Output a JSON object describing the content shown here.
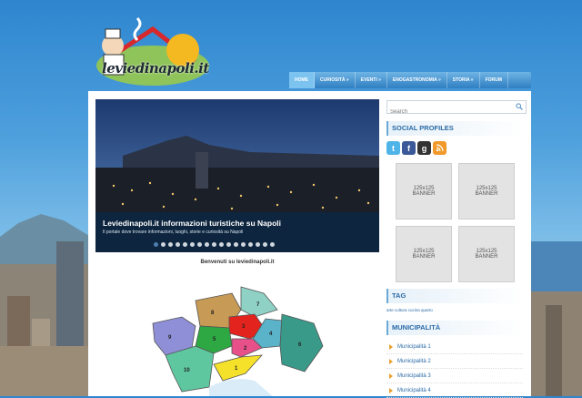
{
  "logo": {
    "text": "leviedinapoli.it"
  },
  "nav": {
    "items": [
      {
        "label": "HOME",
        "active": true
      },
      {
        "label": "CURIOSITÀ »",
        "active": false
      },
      {
        "label": "EVENTI »",
        "active": false
      },
      {
        "label": "ENOGASTRONOMIA »",
        "active": false
      },
      {
        "label": "STORIA »",
        "active": false
      },
      {
        "label": "FORUM",
        "active": false
      }
    ]
  },
  "slider": {
    "title": "Leviedinapoli.it informazioni turistiche su Napoli",
    "description": "Il portale dove trovare informazioni, luoghi, storie e curiosità su Napoli",
    "dot_count": 17,
    "active_dot": 0
  },
  "main": {
    "welcome": "Benvenuti su leviedinapoli.it"
  },
  "map": {
    "areas": [
      {
        "label": "1",
        "color": "#f5e12a"
      },
      {
        "label": "2",
        "color": "#e8508a"
      },
      {
        "label": "3",
        "color": "#e3231d"
      },
      {
        "label": "4",
        "color": "#5bb3c9"
      },
      {
        "label": "5",
        "color": "#2da843"
      },
      {
        "label": "6",
        "color": "#3a9a8a"
      },
      {
        "label": "7",
        "color": "#8fd1c5"
      },
      {
        "label": "8",
        "color": "#c79a55"
      },
      {
        "label": "9",
        "color": "#8e8fd6"
      },
      {
        "label": "10",
        "color": "#5ec7a0"
      }
    ]
  },
  "sidebar": {
    "search_placeholder": "Search",
    "social_title": "SOCIAL PROFILES",
    "social_icons": [
      "twitter-icon",
      "facebook-icon",
      "google-plus-icon",
      "rss-icon"
    ],
    "banners": [
      {
        "line1": "125x125",
        "line2": "BANNER"
      },
      {
        "line1": "125x125",
        "line2": "BANNER"
      },
      {
        "line1": "125x125",
        "line2": "BANNER"
      },
      {
        "line1": "125x125",
        "line2": "BANNER"
      }
    ],
    "tag_title": "TAG",
    "tag_text": "arte cultura cucina quarto",
    "muni_title": "MUNICIPALITÀ",
    "municipalities": [
      "Municipalità 1",
      "Municipalità 2",
      "Municipalità 3",
      "Municipalità 4"
    ]
  },
  "colors": {
    "accent": "#2a6aa6",
    "nav": "#2f7fc2",
    "bullet": "#e8a02f"
  }
}
